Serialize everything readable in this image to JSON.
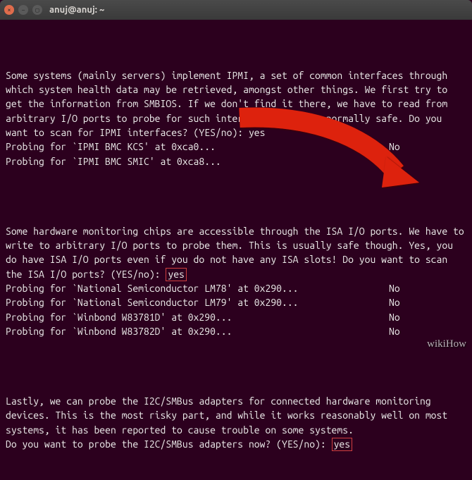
{
  "window": {
    "title": "anuj@anuj: ~"
  },
  "block1": {
    "text": "Some systems (mainly servers) implement IPMI, a set of common interfaces through which system health data may be retrieved, amongst other things. We first try to get the information from SMBIOS. If we don't find it there, we have to read from arbitrary I/O ports to probe for such interfaces. This is normally safe. Do you want to scan for IPMI interfaces? (YES/no): ",
    "answer": "yes",
    "probes": [
      {
        "label": "Probing for `IPMI BMC KCS' at 0xca0...",
        "result": "No"
      },
      {
        "label": "Probing for `IPMI BMC SMIC' at 0xca8...",
        "result": "No"
      }
    ]
  },
  "block2": {
    "text_a": "Some hardware monitoring chips are accessible through the ISA I/O ports. We have to write to arbitrary I/O ports to probe them. This is usually safe though. Yes, you do have ISA I/O ports even if you do not have any ISA slots! Do you want to scan the ISA I/O ports? (YES/no): ",
    "answer": "yes",
    "probes": [
      {
        "label": "Probing for `National Semiconductor LM78' at 0x290...",
        "result": "No"
      },
      {
        "label": "Probing for `National Semiconductor LM79' at 0x290...",
        "result": "No"
      },
      {
        "label": "Probing for `Winbond W83781D' at 0x290...",
        "result": "No"
      },
      {
        "label": "Probing for `Winbond W83782D' at 0x290...",
        "result": "No"
      }
    ]
  },
  "block3": {
    "text": "Lastly, we can probe the I2C/SMBus adapters for connected hardware monitoring devices. This is the most risky part, and while it works reasonably well on most systems, it has been reported to cause trouble on some systems.",
    "prompt": "Do you want to probe the I2C/SMBus adapters now? (YES/no): ",
    "answer": "yes"
  },
  "watermark": "wikiHow"
}
